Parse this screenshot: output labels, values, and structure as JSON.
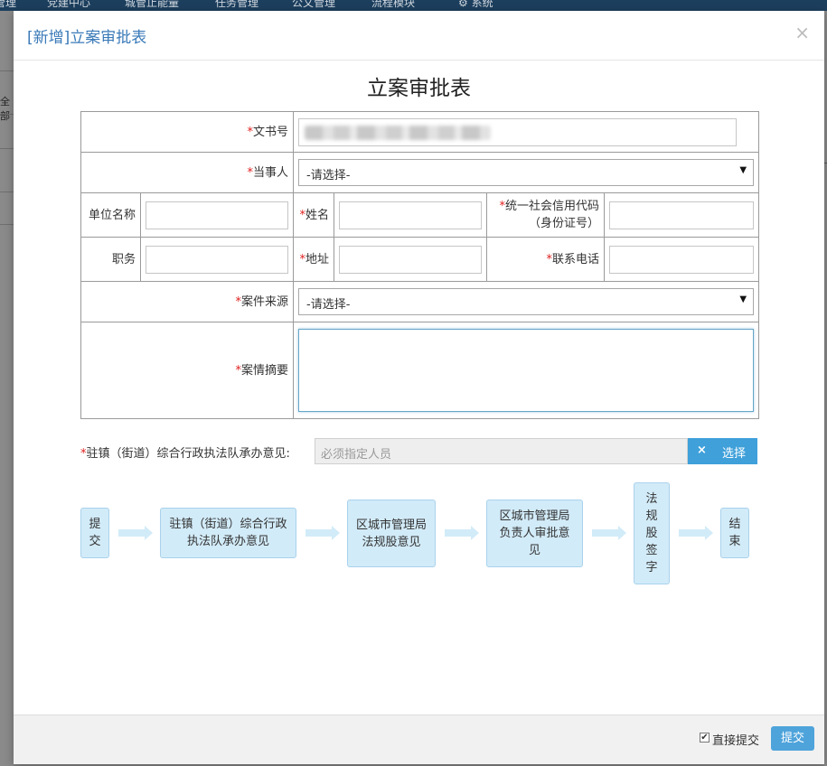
{
  "background": {
    "nav_items": [
      "管理",
      "党建中心",
      "城管止能量",
      "任务管理",
      "公文管理",
      "流程模块",
      "系统"
    ],
    "side_label": "全部"
  },
  "modal": {
    "title": "[新增]立案审批表",
    "close_glyph": "×",
    "form_title": "立案审批表"
  },
  "form": {
    "required_mark": "*",
    "doc_number_label": "文书号",
    "party_label": "当事人",
    "party_value": "-请选择-",
    "unit_name_label": "单位名称",
    "name_label": "姓名",
    "credit_code_label": "统一社会信用代码（身份证号）",
    "position_label": "职务",
    "address_label": "地址",
    "phone_label": "联系电话",
    "case_source_label": "案件来源",
    "case_source_value": "-请选择-",
    "case_summary_label": "案情摘要"
  },
  "opinion": {
    "label": "驻镇（街道）综合行政执法队承办意见:",
    "placeholder": "必须指定人员",
    "clear_glyph": "×",
    "select_label": "选择"
  },
  "flow": {
    "steps": [
      "提交",
      "驻镇（街道）综合行政执法队承办意见",
      "区城市管理局法规股意见",
      "区城市管理局负责人审批意见",
      "法规股签字",
      "结束"
    ]
  },
  "footer": {
    "direct_submit_label": "直接提交",
    "direct_submit_checked": true,
    "check_glyph": "✔",
    "submit_label": "提交"
  },
  "colors": {
    "accent": "#3fa0da",
    "title_blue": "#3a7ab8",
    "required": "#e02020",
    "flow_fill": "#d2ebf8"
  }
}
